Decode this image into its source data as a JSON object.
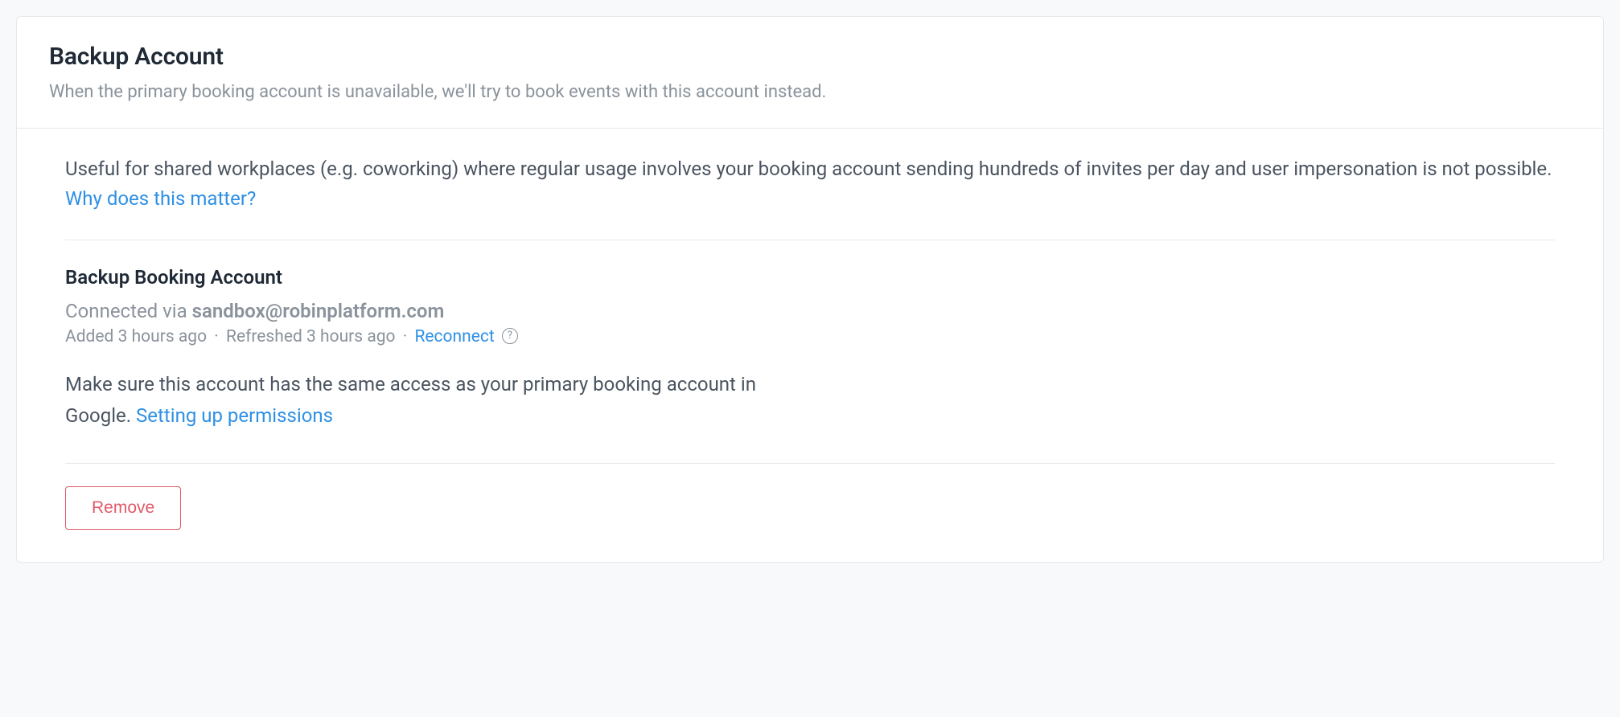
{
  "header": {
    "title": "Backup Account",
    "subtitle": "When the primary booking account is unavailable, we'll try to book events with this account instead."
  },
  "body": {
    "description": "Useful for shared workplaces (e.g. coworking) where regular usage involves your booking account sending hundreds of invites per day and user impersonation is not possible. ",
    "why_link": "Why does this matter?",
    "section_title": "Backup Booking Account",
    "connected_prefix": "Connected via ",
    "connected_email": "sandbox@robinplatform.com",
    "added_text": "Added 3 hours ago",
    "refreshed_text": "Refreshed 3 hours ago",
    "reconnect_label": "Reconnect",
    "help_glyph": "?",
    "helper_text": "Make sure this account has the same access as your primary booking account in Google. ",
    "permissions_link": "Setting up permissions",
    "remove_label": "Remove",
    "separator": "·"
  }
}
